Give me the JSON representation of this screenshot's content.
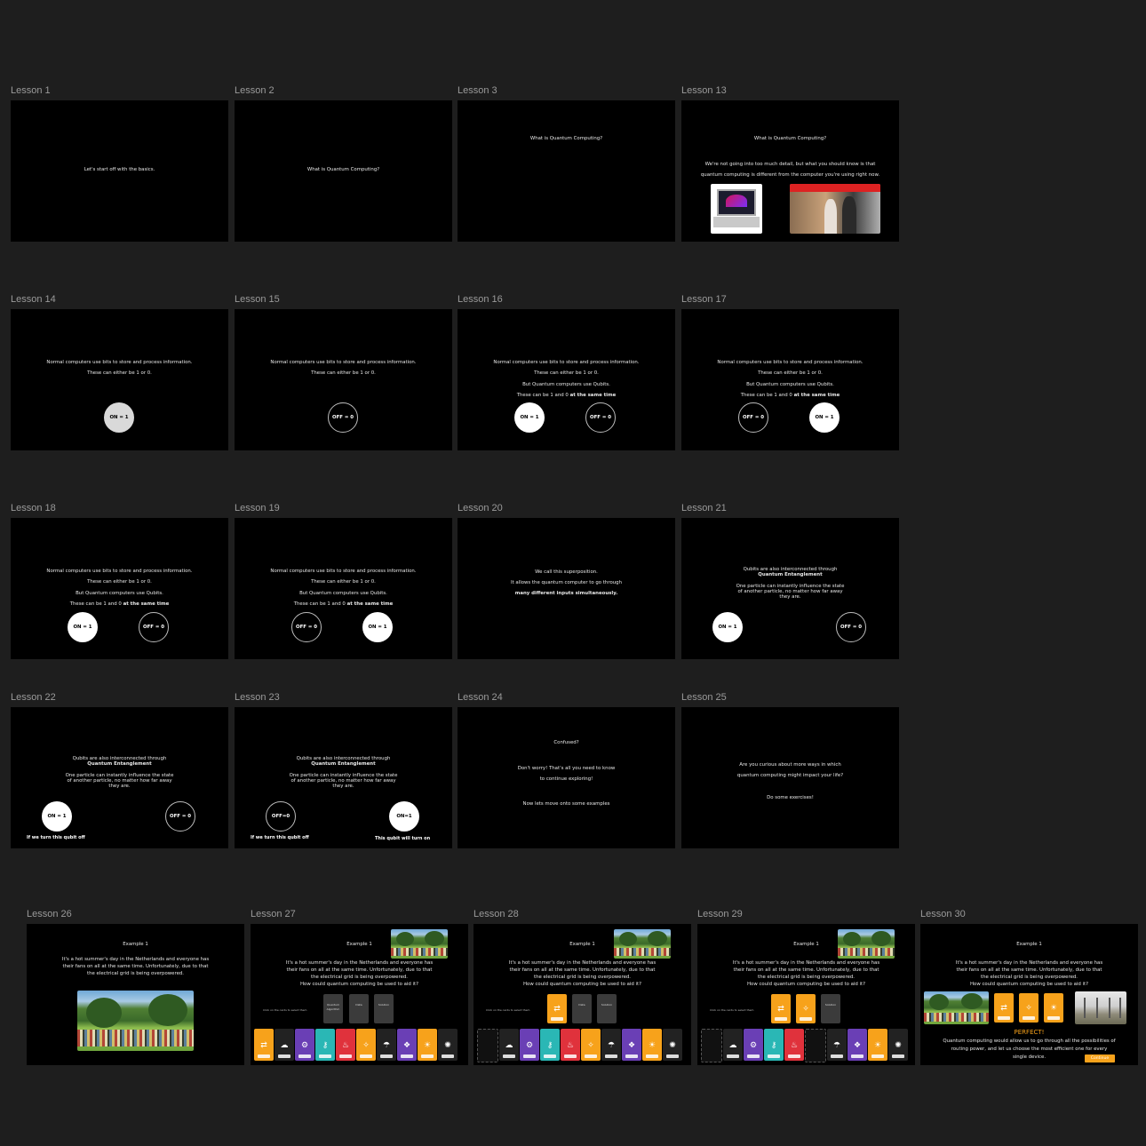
{
  "canvas": {
    "background": "#1e1e1e",
    "accent": "#f7a21b"
  },
  "lessons": [
    {
      "label": "Lesson 1",
      "lines": [
        "Let's start off with the basics."
      ]
    },
    {
      "label": "Lesson 2",
      "lines": [
        "What is Quantum Computing?"
      ]
    },
    {
      "label": "Lesson 3",
      "lines": [
        "What is Quantum Computing?"
      ]
    },
    {
      "label": "Lesson 13",
      "lines": [
        "What is Quantum Computing?",
        "We're not going into too much detail, but what you should know is that",
        "quantum computing is different from the computer you're using right now."
      ],
      "images": [
        "laptop",
        "quantum-lab"
      ]
    },
    {
      "label": "Lesson 14",
      "lines": [
        "Normal computers use bits to store and process information.",
        "These can either be 1 or 0."
      ],
      "circles": [
        "ON = 1"
      ]
    },
    {
      "label": "Lesson 15",
      "lines": [
        "Normal computers use bits to store and process information.",
        "These can either be 1 or 0."
      ],
      "circles": [
        "OFF = 0"
      ]
    },
    {
      "label": "Lesson 16",
      "lines": [
        "Normal computers use bits to store and process information.",
        "These can either be 1 or 0.",
        "But Quantum computers use Qubits.",
        "These can be 1 and 0",
        "at the same time"
      ],
      "circles": [
        "ON = 1",
        "OFF = 0"
      ]
    },
    {
      "label": "Lesson 17",
      "lines": [
        "Normal computers use bits to store and process information.",
        "These can either be 1 or 0.",
        "But Quantum computers use Qubits.",
        "These can be 1 and 0",
        "at the same time"
      ],
      "circles": [
        "OFF = 0",
        "ON = 1"
      ]
    },
    {
      "label": "Lesson 18",
      "lines": [
        "Normal computers use bits to store and process information.",
        "These can either be 1 or 0.",
        "But Quantum computers use Qubits.",
        "These can be 1 and 0",
        "at the same time"
      ],
      "circles": [
        "ON = 1",
        "OFF = 0"
      ]
    },
    {
      "label": "Lesson 19",
      "lines": [
        "Normal computers use bits to store and process information.",
        "These can either be 1 or 0.",
        "But Quantum computers use Qubits.",
        "These can be 1 and 0",
        "at the same time"
      ],
      "circles": [
        "OFF = 0",
        "ON = 1"
      ]
    },
    {
      "label": "Lesson 20",
      "lines": [
        "We call this superposition.",
        "It allows the quantum computer to go through",
        "many different inputs simultaneously."
      ]
    },
    {
      "label": "Lesson 21",
      "lines": [
        "Qubits are also interconnected through",
        "Quantum Entanglement",
        "One particle can instantly influence the state",
        "of another particle, no matter how far away",
        "they are."
      ],
      "circles": [
        "ON = 1",
        "OFF = 0"
      ]
    },
    {
      "label": "Lesson 22",
      "lines": [
        "Qubits are also interconnected through",
        "Quantum Entanglement",
        "One particle can instantly influence the state",
        "of another particle, no matter how far away",
        "they are."
      ],
      "circles": [
        "ON = 1",
        "OFF = 0"
      ],
      "captions": [
        "If we turn this qubit off"
      ]
    },
    {
      "label": "Lesson 23",
      "lines": [
        "Qubits are also interconnected through",
        "Quantum Entanglement",
        "One particle can instantly influence the state",
        "of another particle, no matter how far away",
        "they are."
      ],
      "circles": [
        "OFF=0",
        "ON=1"
      ],
      "captions": [
        "If we turn this qubit off",
        "This qubit will turn on"
      ]
    },
    {
      "label": "Lesson 24",
      "lines": [
        "Confused?",
        "Don't worry! That's all you need to know",
        "to continue exploring!",
        "Now lets move onto some examples"
      ]
    },
    {
      "label": "Lesson 25",
      "lines": [
        "Are you curious about more ways in which",
        "quantum computing might impact your life?",
        "Do some exercises!"
      ]
    },
    {
      "label": "Lesson 26",
      "lines": [
        "Example 1",
        "It's a hot summer's day in the Netherlands and everyone has",
        "their fans on all at the same time. Unfortunately, due to that",
        "the electrical grid is being overpowered."
      ]
    },
    {
      "label": "Lesson 27",
      "lines": [
        "Example 1",
        "It's a hot summer's day in the Netherlands and everyone has",
        "their fans on all at the same time. Unfortunately, due to that",
        "the electrical grid is being overpowered.",
        "How could quantum computing be used to aid it?"
      ],
      "hint": "Click on the cards to select them",
      "options": [
        "Quantum Algorithm",
        "Data",
        "Solution"
      ]
    },
    {
      "label": "Lesson 28",
      "lines": [
        "Example 1",
        "It's a hot summer's day in the Netherlands and everyone has",
        "their fans on all at the same time. Unfortunately, due to that",
        "the electrical grid is being overpowered.",
        "How could quantum computing be used to aid it?"
      ],
      "hint": "Click on the cards to select them",
      "options": [
        "Data",
        "Solution"
      ]
    },
    {
      "label": "Lesson 29",
      "lines": [
        "Example 1",
        "It's a hot summer's day in the Netherlands and everyone has",
        "their fans on all at the same time. Unfortunately, due to that",
        "the electrical grid is being overpowered.",
        "How could quantum computing be used to aid it?"
      ],
      "hint": "Click on the cards to select them",
      "options": [
        "Solution"
      ]
    },
    {
      "label": "Lesson 30",
      "lines": [
        "Example 1",
        "It's a hot summer's day in the Netherlands and everyone has",
        "their fans on all at the same time. Unfortunately, due to that",
        "the electrical grid is being overpowered.",
        "How could quantum computing be used to aid it?"
      ],
      "result": "PERFECT!",
      "explain": [
        "Quantum computing would allow us to go through all the possibilities of",
        "routing power, and let us choose the most efficient one for every",
        "single device."
      ],
      "button": "Continue"
    }
  ],
  "card_colors": {
    "orange": "#f7a21b",
    "purple": "#6a3fb5",
    "teal": "#2ab7b5",
    "red": "#e0323c",
    "dark": "#222222"
  }
}
